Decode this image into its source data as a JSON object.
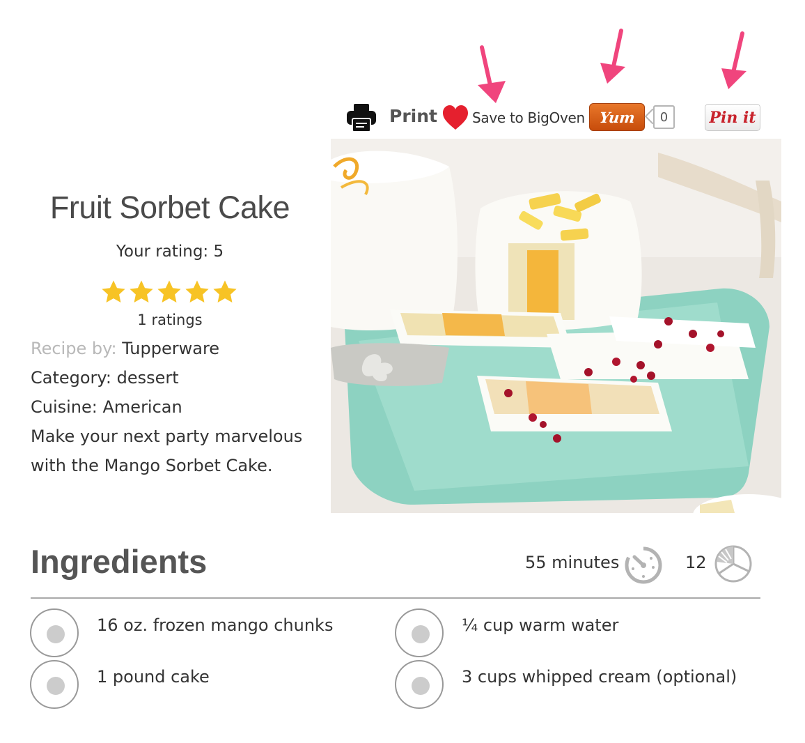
{
  "toolbar": {
    "print_label": "Print",
    "save_label": "Save to BigOven",
    "yum_label": "Yum",
    "yum_count": "0",
    "pin_label": "Pin it",
    "arrow_color": "#f0457d"
  },
  "recipe": {
    "title": "Fruit Sorbet Cake",
    "your_rating": "Your rating: 5",
    "stars": 5,
    "ratings_count": "1 ratings",
    "recipe_by_key": "Recipe by:",
    "recipe_by_value": "Tupperware",
    "category": "Category: dessert",
    "cuisine": "Cuisine: American",
    "description": "Make your next party marvelous with the Mango Sorbet Cake."
  },
  "ingredients": {
    "heading": "Ingredients",
    "time": "55 minutes",
    "servings": "12",
    "items": [
      "16 oz. frozen mango chunks",
      "¼ cup warm water",
      "1 pound cake",
      "3 cups whipped cream (optional)"
    ]
  },
  "colors": {
    "star": "#f7c325",
    "heart": "#e5202e",
    "yum": "#d8611a",
    "pin": "#c8232c"
  }
}
